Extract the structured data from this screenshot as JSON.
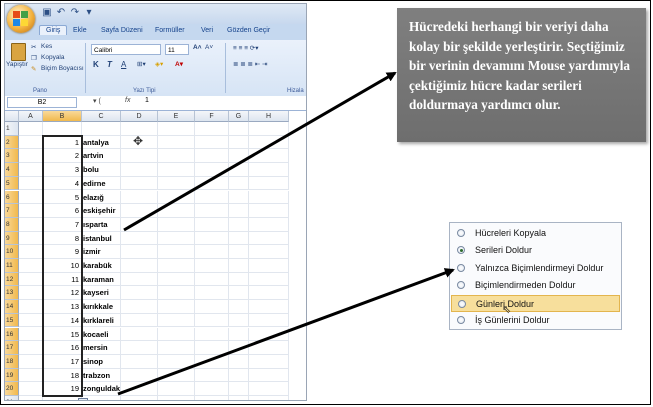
{
  "excel": {
    "tabs": [
      "Giriş",
      "Ekle",
      "Sayfa Düzeni",
      "Formüller",
      "Veri",
      "Gözden Geçir"
    ],
    "clipboard": {
      "paste_label": "Yapıştır",
      "cut_label": "Kes",
      "copy_label": "Kopyala",
      "format_painter_label": "Biçim Boyacısı",
      "group_label": "Pano"
    },
    "font": {
      "name": "Calibri",
      "size": "11",
      "bold": "K",
      "italic": "T",
      "underline": "A",
      "group_label": "Yazı Tipi"
    },
    "alignment": {
      "group_label": "Hizala"
    },
    "formula_bar": {
      "name_box": "B2",
      "fx": "fx",
      "value": "1"
    },
    "columns": [
      "A",
      "B",
      "C",
      "D",
      "E",
      "F",
      "G",
      "H"
    ],
    "rows": [
      {
        "n": "1",
        "b": "",
        "c": ""
      },
      {
        "n": "2",
        "b": "1",
        "c": "antalya"
      },
      {
        "n": "3",
        "b": "2",
        "c": "artvin"
      },
      {
        "n": "4",
        "b": "3",
        "c": "bolu"
      },
      {
        "n": "5",
        "b": "4",
        "c": "edirne"
      },
      {
        "n": "6",
        "b": "5",
        "c": "elazığ"
      },
      {
        "n": "7",
        "b": "6",
        "c": "eskişehir"
      },
      {
        "n": "8",
        "b": "7",
        "c": "ısparta"
      },
      {
        "n": "9",
        "b": "8",
        "c": "istanbul"
      },
      {
        "n": "10",
        "b": "9",
        "c": "izmir"
      },
      {
        "n": "11",
        "b": "10",
        "c": "karabük"
      },
      {
        "n": "12",
        "b": "11",
        "c": "karaman"
      },
      {
        "n": "13",
        "b": "12",
        "c": "kayseri"
      },
      {
        "n": "14",
        "b": "13",
        "c": "kırıkkale"
      },
      {
        "n": "15",
        "b": "14",
        "c": "kırklareli"
      },
      {
        "n": "16",
        "b": "15",
        "c": "kocaeli"
      },
      {
        "n": "17",
        "b": "16",
        "c": "mersin"
      },
      {
        "n": "18",
        "b": "17",
        "c": "sinop"
      },
      {
        "n": "19",
        "b": "18",
        "c": "trabzon"
      },
      {
        "n": "20",
        "b": "19",
        "c": "zonguldak"
      },
      {
        "n": "21",
        "b": "",
        "c": ""
      }
    ]
  },
  "callout": {
    "text": "Hücredeki herhangi bir veriyi daha kolay bir şekilde yerleştirir. Seçtiğimiz bir verinin devamını Mouse  yardımıyla çektiğimiz hücre kadar serileri doldurmaya yardımcı olur."
  },
  "autofill_menu": {
    "items": [
      {
        "label": "Hücreleri Kopyala",
        "selected": false,
        "highlighted": false
      },
      {
        "label": "Serileri Doldur",
        "selected": true,
        "highlighted": false
      },
      {
        "label": "Yalnızca Biçimlendirmeyi Doldur",
        "selected": false,
        "highlighted": false
      },
      {
        "label": "Biçimlendirmeden Doldur",
        "selected": false,
        "highlighted": false
      },
      {
        "label": "Günleri Doldur",
        "selected": false,
        "highlighted": true
      },
      {
        "label": "İş Günlerini Doldur",
        "selected": false,
        "highlighted": false
      }
    ]
  },
  "colors": {
    "callout_bg": "#7f7f7f",
    "callout_text": "#ffffff",
    "selection_border": "#222222",
    "menu_highlight": "#f7df9c"
  }
}
